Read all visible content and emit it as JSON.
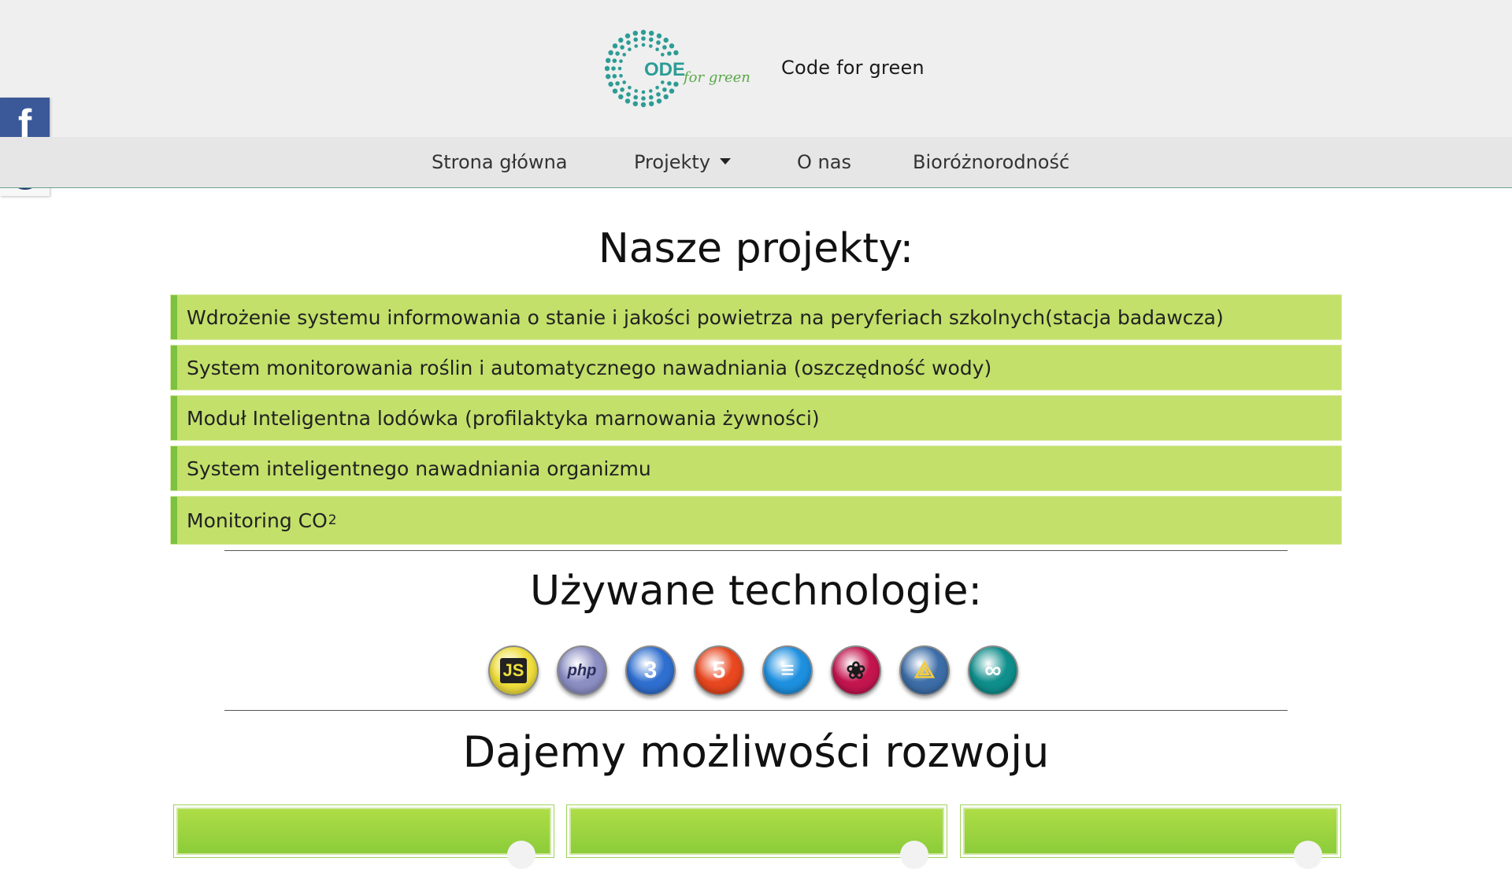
{
  "header": {
    "logo_text": "ODE",
    "logo_script": "for green",
    "site_name": "Code for green"
  },
  "nav": {
    "items": [
      {
        "label": "Strona główna"
      },
      {
        "label": "Projekty",
        "has_dropdown": true
      },
      {
        "label": "O nas"
      },
      {
        "label": "Bioróżnorodność"
      }
    ]
  },
  "social": {
    "facebook_icon": "facebook-icon",
    "portrait_icon": "portrait-icon"
  },
  "projects": {
    "heading": "Nasze projekty:",
    "items": [
      {
        "label": "Wdrożenie systemu informowania o stanie i jakości powietrza na peryferiach szkolnych(stacja badawcza)"
      },
      {
        "label": "System monitorowania roślin i automatycznego nawadniania (oszczędność wody)"
      },
      {
        "label": "Moduł Inteligentna lodówka (profilaktyka marnowania żywności)"
      },
      {
        "label": "System inteligentnego nawadniania organizmu"
      },
      {
        "label": "Monitoring CO",
        "subscript": "2"
      }
    ]
  },
  "technologies": {
    "heading": "Używane technologie:",
    "items": [
      {
        "name": "javascript-icon",
        "glyph": "JS",
        "color": "#f0df3c",
        "fg": "#222222"
      },
      {
        "name": "php-icon",
        "glyph": "php",
        "color": "#8c8fc4",
        "fg": "#2b2d5a"
      },
      {
        "name": "css3-icon",
        "glyph": "3",
        "color": "#2f6fd0",
        "fg": "#ffffff"
      },
      {
        "name": "html5-icon",
        "glyph": "5",
        "color": "#e8471f",
        "fg": "#ffffff"
      },
      {
        "name": "database-icon",
        "glyph": "≡",
        "color": "#1e90e0",
        "fg": "#ffffff"
      },
      {
        "name": "raspberry-pi-icon",
        "glyph": "❀",
        "color": "#c4154f",
        "fg": "#1a1a1a"
      },
      {
        "name": "python-icon",
        "glyph": "⟁",
        "color": "#3d6ea8",
        "fg": "#f5cc3a"
      },
      {
        "name": "arduino-icon",
        "glyph": "∞",
        "color": "#0f8f8c",
        "fg": "#ffffff"
      }
    ]
  },
  "development": {
    "heading": "Dajemy możliwości rozwoju"
  },
  "colors": {
    "project_bg": "#c3e06a",
    "project_accent": "#7bc142",
    "card_green": "#9ed43f"
  }
}
